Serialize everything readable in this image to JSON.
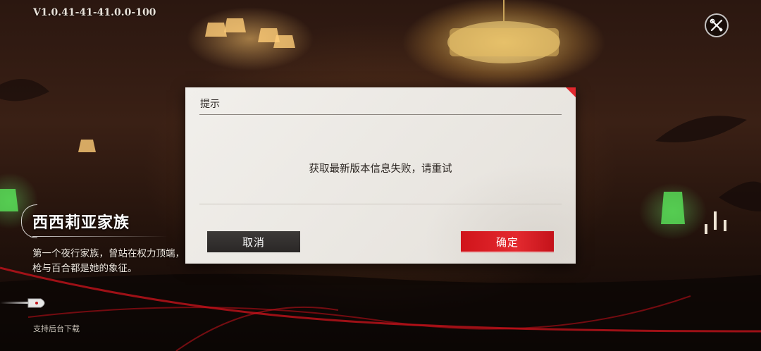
{
  "version": "V1.0.41-41-41.0.0-100",
  "header": {
    "tools_icon": "wrench-screwdriver-icon"
  },
  "family": {
    "title": "西西莉亚家族",
    "desc_line1": "第一个夜行家族，曾站在权力顶端，",
    "desc_line2": "枪与百合都是她的象征。"
  },
  "footer": {
    "bg_download_label": "支持后台下载",
    "bullet_icon": "bullet-icon"
  },
  "dialog": {
    "title": "提示",
    "message": "获取最新版本信息失败，请重试",
    "cancel_label": "取消",
    "confirm_label": "确定"
  },
  "colors": {
    "confirm_button": "#d9191f",
    "cancel_button": "#333030",
    "dialog_bg": "#eeebe6"
  }
}
